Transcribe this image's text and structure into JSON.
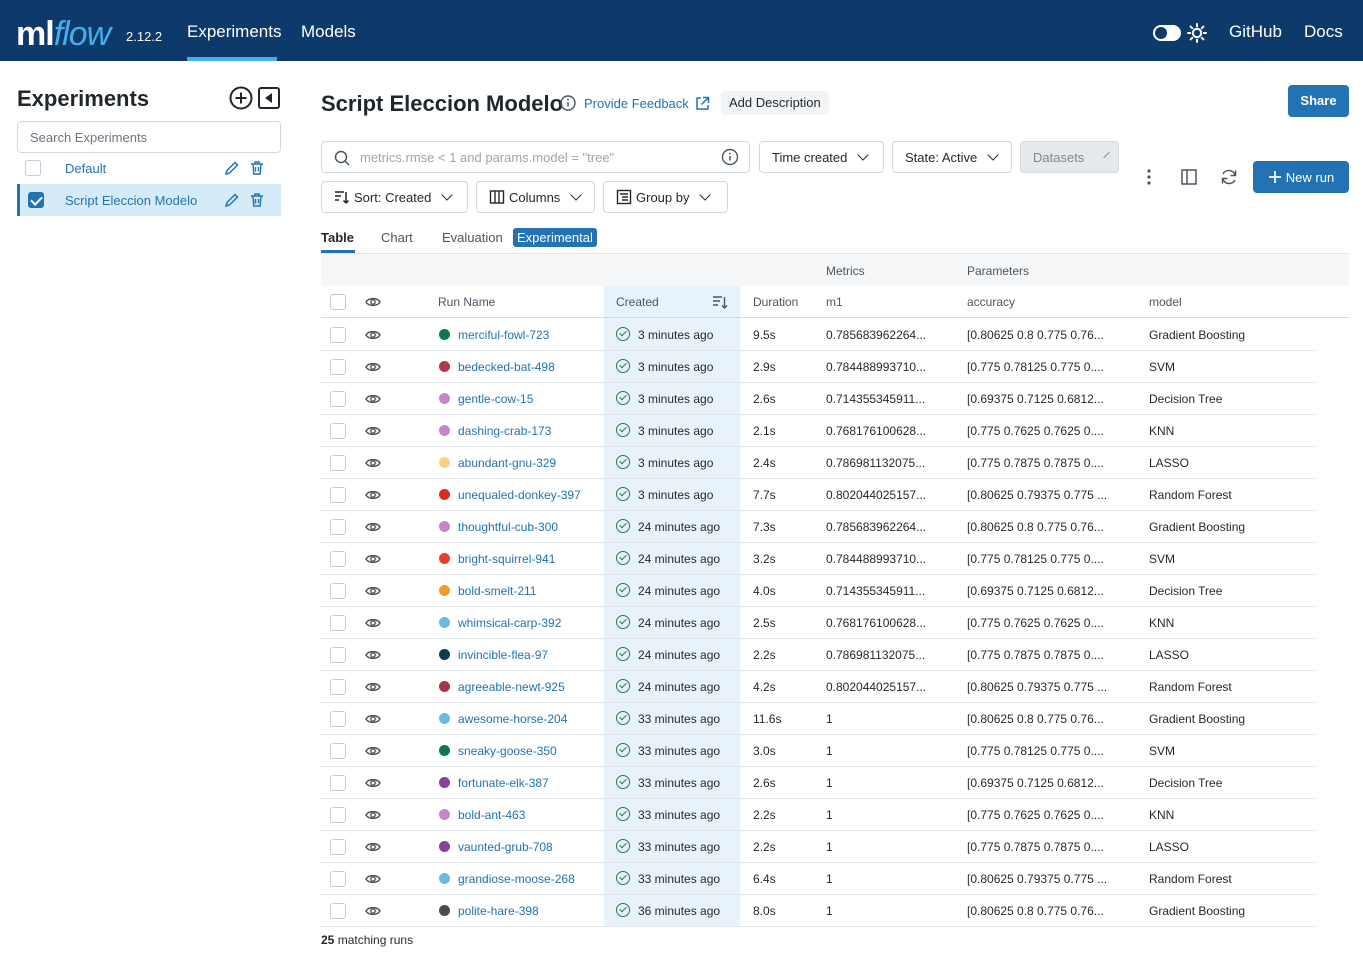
{
  "header": {
    "logo_ml": "ml",
    "logo_flow": "flow",
    "version": "2.12.2",
    "nav": [
      "Experiments",
      "Models"
    ],
    "right_links": [
      "GitHub",
      "Docs"
    ],
    "brand_color": "#0e3a6b",
    "accent_color": "#43b0e9"
  },
  "sidebar": {
    "title": "Experiments",
    "search_placeholder": "Search Experiments",
    "experiments": [
      {
        "name": "Default",
        "checked": false
      },
      {
        "name": "Script Eleccion Modelo",
        "checked": true
      }
    ]
  },
  "page": {
    "title": "Script Eleccion Modelo",
    "feedback": "Provide Feedback",
    "add_description": "Add Description",
    "share": "Share"
  },
  "filters": {
    "search_placeholder": "metrics.rmse < 1 and params.model = \"tree\"",
    "time_created": "Time created",
    "state": "State: Active",
    "datasets": "Datasets",
    "sort": "Sort: Created",
    "columns": "Columns",
    "group_by": "Group by",
    "new_run": "New run"
  },
  "tabs": [
    "Table",
    "Chart",
    "Evaluation"
  ],
  "experimental_badge": "Experimental",
  "table": {
    "group_headers": {
      "metrics": "Metrics",
      "parameters": "Parameters"
    },
    "columns": [
      "Run Name",
      "Created",
      "Duration",
      "m1",
      "accuracy",
      "model"
    ],
    "rows": [
      {
        "name": "merciful-fowl-723",
        "color": "#0a7a4e",
        "created": "3 minutes ago",
        "duration": "9.5s",
        "m1": "0.785683962264...",
        "accuracy": "[0.80625 0.8 0.775 0.76...",
        "model": "Gradient Boosting"
      },
      {
        "name": "bedecked-bat-498",
        "color": "#b0384f",
        "created": "3 minutes ago",
        "duration": "2.9s",
        "m1": "0.784488993710...",
        "accuracy": "[0.775 0.78125 0.775 0....",
        "model": "SVM"
      },
      {
        "name": "gentle-cow-15",
        "color": "#c587c9",
        "created": "3 minutes ago",
        "duration": "2.6s",
        "m1": "0.714355345911...",
        "accuracy": "[0.69375 0.7125 0.6812...",
        "model": "Decision Tree"
      },
      {
        "name": "dashing-crab-173",
        "color": "#c587c9",
        "created": "3 minutes ago",
        "duration": "2.1s",
        "m1": "0.768176100628...",
        "accuracy": "[0.775 0.7625 0.7625 0....",
        "model": "KNN"
      },
      {
        "name": "abundant-gnu-329",
        "color": "#f9d27c",
        "created": "3 minutes ago",
        "duration": "2.4s",
        "m1": "0.786981132075...",
        "accuracy": "[0.775 0.7875 0.7875 0....",
        "model": "LASSO"
      },
      {
        "name": "unequaled-donkey-397",
        "color": "#dc2c22",
        "created": "3 minutes ago",
        "duration": "7.7s",
        "m1": "0.802044025157...",
        "accuracy": "[0.80625 0.79375 0.775 ...",
        "model": "Random Forest"
      },
      {
        "name": "thoughtful-cub-300",
        "color": "#c587c9",
        "created": "24 minutes ago",
        "duration": "7.3s",
        "m1": "0.785683962264...",
        "accuracy": "[0.80625 0.8 0.775 0.76...",
        "model": "Gradient Boosting"
      },
      {
        "name": "bright-squirrel-941",
        "color": "#ef3b2c",
        "created": "24 minutes ago",
        "duration": "3.2s",
        "m1": "0.784488993710...",
        "accuracy": "[0.775 0.78125 0.775 0....",
        "model": "SVM"
      },
      {
        "name": "bold-smelt-211",
        "color": "#f39c2a",
        "created": "24 minutes ago",
        "duration": "4.0s",
        "m1": "0.714355345911...",
        "accuracy": "[0.69375 0.7125 0.6812...",
        "model": "Decision Tree"
      },
      {
        "name": "whimsical-carp-392",
        "color": "#6bbce3",
        "created": "24 minutes ago",
        "duration": "2.5s",
        "m1": "0.768176100628...",
        "accuracy": "[0.775 0.7625 0.7625 0....",
        "model": "KNN"
      },
      {
        "name": "invincible-flea-97",
        "color": "#0d3b4f",
        "created": "24 minutes ago",
        "duration": "2.2s",
        "m1": "0.786981132075...",
        "accuracy": "[0.775 0.7875 0.7875 0....",
        "model": "LASSO"
      },
      {
        "name": "agreeable-newt-925",
        "color": "#a8334d",
        "created": "24 minutes ago",
        "duration": "4.2s",
        "m1": "0.802044025157...",
        "accuracy": "[0.80625 0.79375 0.775 ...",
        "model": "Random Forest"
      },
      {
        "name": "awesome-horse-204",
        "color": "#6bbce3",
        "created": "33 minutes ago",
        "duration": "11.6s",
        "m1": "1",
        "accuracy": "[0.80625 0.8 0.775 0.76...",
        "model": "Gradient Boosting"
      },
      {
        "name": "sneaky-goose-350",
        "color": "#0a7a4e",
        "created": "33 minutes ago",
        "duration": "3.0s",
        "m1": "1",
        "accuracy": "[0.775 0.78125 0.775 0....",
        "model": "SVM"
      },
      {
        "name": "fortunate-elk-387",
        "color": "#8a3f9a",
        "created": "33 minutes ago",
        "duration": "2.6s",
        "m1": "1",
        "accuracy": "[0.69375 0.7125 0.6812...",
        "model": "Decision Tree"
      },
      {
        "name": "bold-ant-463",
        "color": "#c587c9",
        "created": "33 minutes ago",
        "duration": "2.2s",
        "m1": "1",
        "accuracy": "[0.775 0.7625 0.7625 0....",
        "model": "KNN"
      },
      {
        "name": "vaunted-grub-708",
        "color": "#8a3f9a",
        "created": "33 minutes ago",
        "duration": "2.2s",
        "m1": "1",
        "accuracy": "[0.775 0.7875 0.7875 0....",
        "model": "LASSO"
      },
      {
        "name": "grandiose-moose-268",
        "color": "#6bbce3",
        "created": "33 minutes ago",
        "duration": "6.4s",
        "m1": "1",
        "accuracy": "[0.80625 0.79375 0.775 ...",
        "model": "Random Forest"
      },
      {
        "name": "polite-hare-398",
        "color": "#4a4a4a",
        "created": "36 minutes ago",
        "duration": "8.0s",
        "m1": "1",
        "accuracy": "[0.80625 0.8 0.775 0.76...",
        "model": "Gradient Boosting"
      }
    ]
  },
  "footer": {
    "count": "25",
    "suffix": "matching runs"
  }
}
